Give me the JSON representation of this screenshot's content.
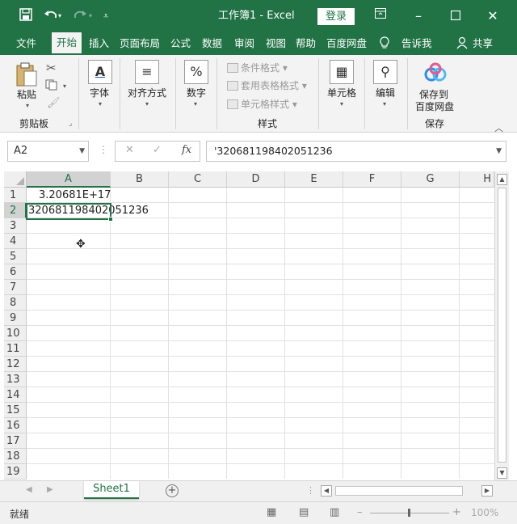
{
  "titlebar": {
    "title": "工作簿1  -  Excel",
    "login_label": "登录",
    "icons": [
      "save-icon",
      "undo-icon",
      "redo-icon",
      "customize-qat-icon",
      "ribbon-display-icon",
      "minimize-icon",
      "maximize-icon",
      "close-icon"
    ]
  },
  "tabs": [
    "文件",
    "开始",
    "插入",
    "页面布局",
    "公式",
    "数据",
    "审阅",
    "视图",
    "帮助",
    "百度网盘",
    "告诉我",
    "共享"
  ],
  "active_tab": "开始",
  "ribbon": {
    "paste_label": "粘贴",
    "clipboard_group": "剪贴板",
    "font_label": "字体",
    "align_label": "对齐方式",
    "number_label": "数字",
    "cond_format_label": "条件格式",
    "table_format_label": "套用表格格式",
    "cell_style_label": "单元格样式",
    "styles_group": "样式",
    "cells_label": "单元格",
    "edit_label": "编辑",
    "save_to_label_1": "保存到",
    "save_to_label_2": "百度网盘",
    "save_group": "保存"
  },
  "formula_bar": {
    "name_box": "A2",
    "formula": "'320681198402051236"
  },
  "grid": {
    "columns": [
      "A",
      "B",
      "C",
      "D",
      "E",
      "F",
      "G",
      "H"
    ],
    "rows": [
      "1",
      "2",
      "3",
      "4",
      "5",
      "6",
      "7",
      "8",
      "9",
      "10",
      "11",
      "12",
      "13",
      "14",
      "15",
      "16",
      "17",
      "18",
      "19"
    ],
    "cells": {
      "A1": "3.20681E+17",
      "A2": "320681198402051236"
    },
    "selected_cell": "A2"
  },
  "sheets": [
    "Sheet1"
  ],
  "status": {
    "ready_text": "就绪",
    "zoom": "100%"
  },
  "colors": {
    "accent": "#217346",
    "ribbon_bg": "#f3f3f3"
  }
}
